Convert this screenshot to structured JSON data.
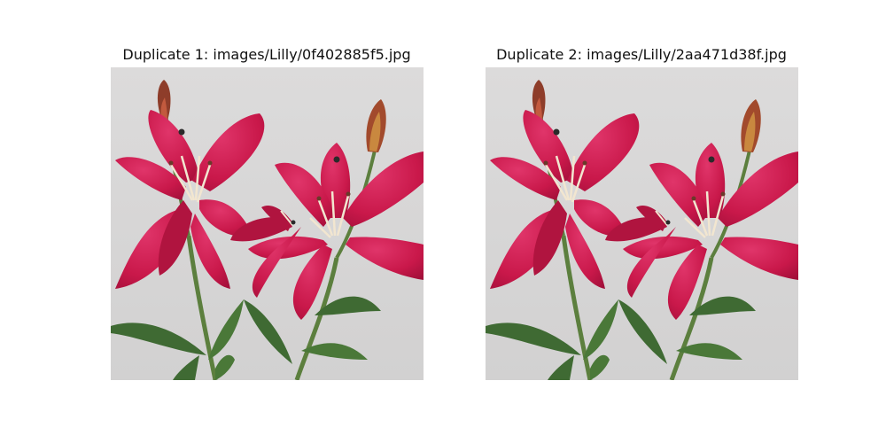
{
  "panels": [
    {
      "title": "Duplicate 1: images/Lilly/0f402885f5.jpg",
      "image_subject": "two red lily flowers with buds on a light grey background"
    },
    {
      "title": "Duplicate 2: images/Lilly/2aa471d38f.jpg",
      "image_subject": "two red lily flowers with buds on a light grey background"
    }
  ],
  "colors": {
    "background": "#d9d8d8",
    "petal": "#c9184a",
    "petal_dark": "#9e0f38",
    "stem": "#4f7a3a",
    "leaf": "#3f6a33",
    "stamen": "#f2e6d0",
    "bud": "#8e3d2a"
  }
}
